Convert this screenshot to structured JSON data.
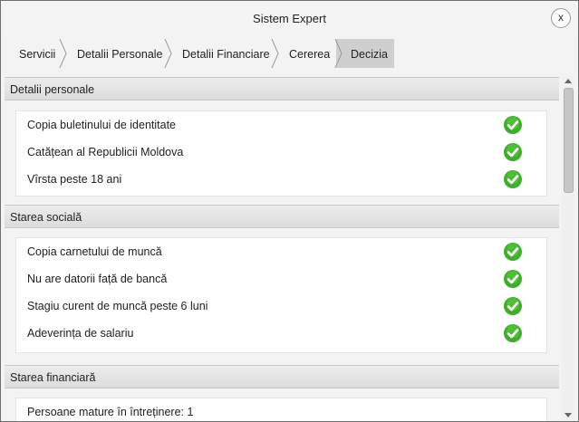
{
  "window": {
    "title": "Sistem Expert",
    "close_label": "x"
  },
  "breadcrumb": [
    {
      "label": "Servicii"
    },
    {
      "label": "Detalii Personale"
    },
    {
      "label": "Detalii Financiare"
    },
    {
      "label": "Cererea"
    },
    {
      "label": "Decizia",
      "active": true
    }
  ],
  "sections": {
    "personal": {
      "title": "Detalii personale",
      "items": [
        {
          "label": "Copia buletinului de identitate",
          "status": "check-icon"
        },
        {
          "label": "Catățean al Republicii Moldova",
          "status": "check-icon"
        },
        {
          "label": "Vîrsta peste 18 ani",
          "status": "check-icon"
        }
      ]
    },
    "social": {
      "title": "Starea socială",
      "items": [
        {
          "label": "Copia carnetului de muncă",
          "status": "check-icon"
        },
        {
          "label": "Nu are datorii față de bancă",
          "status": "check-icon"
        },
        {
          "label": "Stagiu curent de muncă peste 6 luni",
          "status": "check-icon"
        },
        {
          "label": "Adeverința de salariu",
          "status": "check-icon"
        }
      ]
    },
    "financial": {
      "title": "Starea financiară",
      "items": [
        {
          "label": "Persoane mature în întreținere: 1"
        }
      ]
    }
  },
  "colors": {
    "check_green": "#3fae2a",
    "active_crumb": "#cfcfcf"
  }
}
